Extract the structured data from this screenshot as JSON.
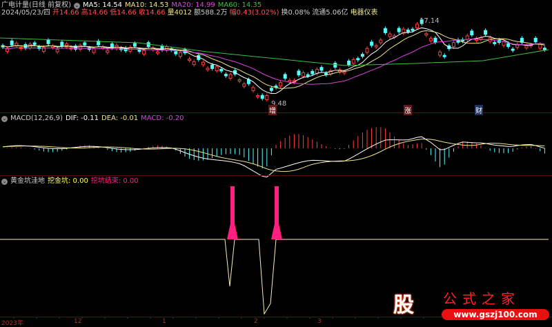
{
  "header": {
    "title": "广电计量(日线 前复权)",
    "ma5": "MA5: 14.54",
    "ma10": "MA10: 14.53",
    "ma20": "MA20: 14.99",
    "ma60": "MA60: 14.35",
    "date": "2024/05/23/四",
    "open": "开14.66",
    "high": "高14.66",
    "low": "低14.66",
    "close": "收14.66",
    "volume": "量4012",
    "amount": "额588.2万",
    "change": "幅0.43(3.02%)",
    "turnover": "换0.08%",
    "float": "流通5.06亿",
    "industry": "电器仪表"
  },
  "main": {
    "high_label": "17.14",
    "low_label": "9.48",
    "markers": [
      "增",
      "涨",
      "财"
    ]
  },
  "macd": {
    "title": "MACD(12,26,9)",
    "dif": "DIF: -0.11",
    "dea": "DEA: -0.01",
    "macd": "MACD: -0.20"
  },
  "indicator": {
    "title": "黄金坑洼地",
    "dig": "挖金坑: 0.00",
    "dig_end": "挖坑结束: 0.00"
  },
  "xaxis": [
    "2023年",
    "12",
    "1",
    "2",
    "3"
  ],
  "watermark": {
    "logo": "股",
    "name": "公式之家",
    "url": "www.gszj100.com"
  },
  "colors": {
    "up": "#ff4040",
    "down": "#54ffff",
    "ma5": "#ffffff",
    "ma10": "#f0e68c",
    "ma20": "#e040e0",
    "ma60": "#40c040",
    "dig": "#ffff60",
    "spike": "#ff2080"
  }
}
